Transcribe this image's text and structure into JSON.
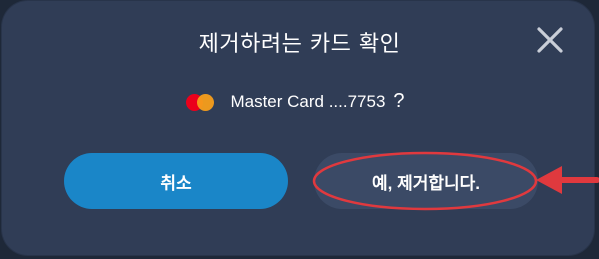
{
  "dialog": {
    "title": "제거하려는 카드 확인",
    "close_icon": "close-icon",
    "card": {
      "brand_icon": "mastercard-logo",
      "label": "Master Card ....7753",
      "question_mark": "?"
    },
    "buttons": {
      "cancel_label": "취소",
      "confirm_label": "예, 제거합니다."
    }
  },
  "colors": {
    "dialog_bg": "#303d56",
    "cancel_button": "#1a86c8",
    "confirm_button": "#3b4a66",
    "annotation": "#e0393e"
  }
}
